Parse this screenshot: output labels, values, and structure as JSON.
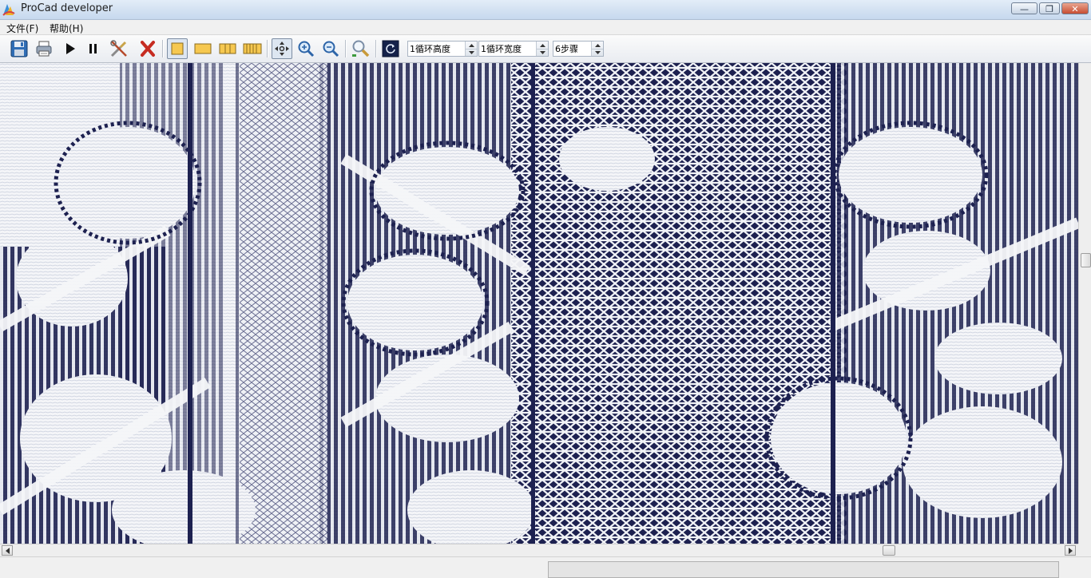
{
  "window": {
    "title": "ProCad developer",
    "minimize_icon": "minimize-icon",
    "restore_icon": "restore-icon",
    "close_icon": "close-icon"
  },
  "menu": {
    "items": [
      {
        "label": "文件(F)"
      },
      {
        "label": "帮助(H)"
      }
    ]
  },
  "toolbar": {
    "buttons": [
      {
        "icon": "save-icon"
      },
      {
        "icon": "print-icon"
      },
      {
        "icon": "play-icon"
      },
      {
        "icon": "pause-icon"
      },
      {
        "icon": "tools-icon"
      },
      {
        "icon": "delete-icon"
      },
      {
        "icon": "view-single-icon",
        "pressed": true
      },
      {
        "icon": "view-wide-icon"
      },
      {
        "icon": "view-double-icon"
      },
      {
        "icon": "view-multi-icon"
      },
      {
        "icon": "pan-icon",
        "pressed": true
      },
      {
        "icon": "zoom-in-icon"
      },
      {
        "icon": "zoom-out-icon"
      },
      {
        "icon": "zoom-fit-icon"
      },
      {
        "icon": "refresh-icon"
      }
    ],
    "spin_height": {
      "value": "1循环高度"
    },
    "spin_width": {
      "value": "1循环宽度"
    },
    "spin_steps": {
      "value": "6步骤"
    }
  },
  "canvas": {
    "content": "lace-pattern",
    "colors": {
      "thread": "#f4f5f7",
      "ground": "#1d2150",
      "background": "#e9ecf3"
    }
  },
  "colors": {
    "titlebar": "#d4e2f2",
    "toolbar": "#eef0f4",
    "accent": "#3a6ea5"
  }
}
